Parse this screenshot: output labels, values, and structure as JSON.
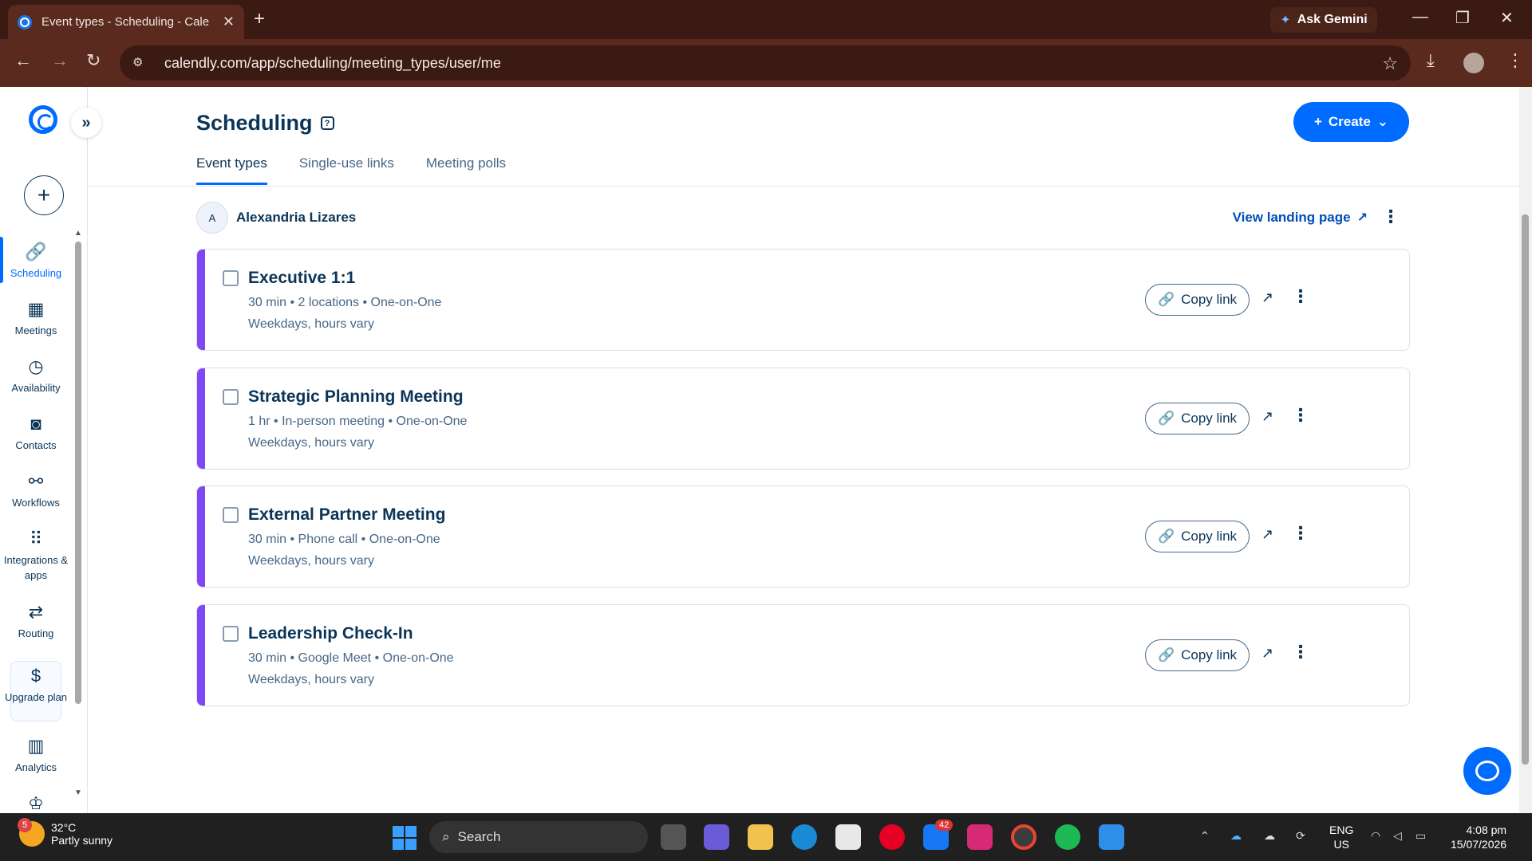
{
  "browser": {
    "tab_title": "Event types - Scheduling - Cale",
    "url": "calendly.com/app/scheduling/meeting_types/user/me",
    "gemini_label": "Ask Gemini"
  },
  "sidebar": {
    "items": [
      {
        "label": "Scheduling",
        "icon": "link-icon"
      },
      {
        "label": "Meetings",
        "icon": "calendar-icon"
      },
      {
        "label": "Availability",
        "icon": "clock-icon"
      },
      {
        "label": "Contacts",
        "icon": "contact-icon"
      },
      {
        "label": "Workflows",
        "icon": "workflow-icon"
      },
      {
        "label": "Integrations & apps",
        "icon": "grid-icon"
      },
      {
        "label": "Routing",
        "icon": "routing-icon"
      },
      {
        "label": "Upgrade plan",
        "icon": "dollar-icon"
      },
      {
        "label": "Analytics",
        "icon": "chart-icon"
      }
    ]
  },
  "header": {
    "title": "Scheduling",
    "create_label": "Create",
    "tabs": [
      "Event types",
      "Single-use links",
      "Meeting polls"
    ]
  },
  "user": {
    "initial": "A",
    "name": "Alexandria Lizares",
    "landing_label": "View landing page"
  },
  "events": [
    {
      "name": "Executive 1:1",
      "meta": "30 min • 2 locations • One-on-One",
      "schedule": "Weekdays, hours vary",
      "copy_label": "Copy link"
    },
    {
      "name": "Strategic Planning Meeting",
      "meta": "1 hr • In-person meeting • One-on-One",
      "schedule": "Weekdays, hours vary",
      "copy_label": "Copy link"
    },
    {
      "name": "External Partner Meeting",
      "meta": "30 min • Phone call • One-on-One",
      "schedule": "Weekdays, hours vary",
      "copy_label": "Copy link"
    },
    {
      "name": "Leadership Check-In",
      "meta": "30 min • Google Meet • One-on-One",
      "schedule": "Weekdays, hours vary",
      "copy_label": "Copy link"
    }
  ],
  "accent_color": "#006bff",
  "event_color": "#8247f5",
  "taskbar": {
    "weather_temp": "32°C",
    "weather_desc": "Partly sunny",
    "weather_badge": "5",
    "search_label": "Search",
    "notif_count": "42",
    "lang_top": "ENG",
    "lang_bottom": "US",
    "time": "4:08 pm",
    "date": "15/07/2026"
  }
}
